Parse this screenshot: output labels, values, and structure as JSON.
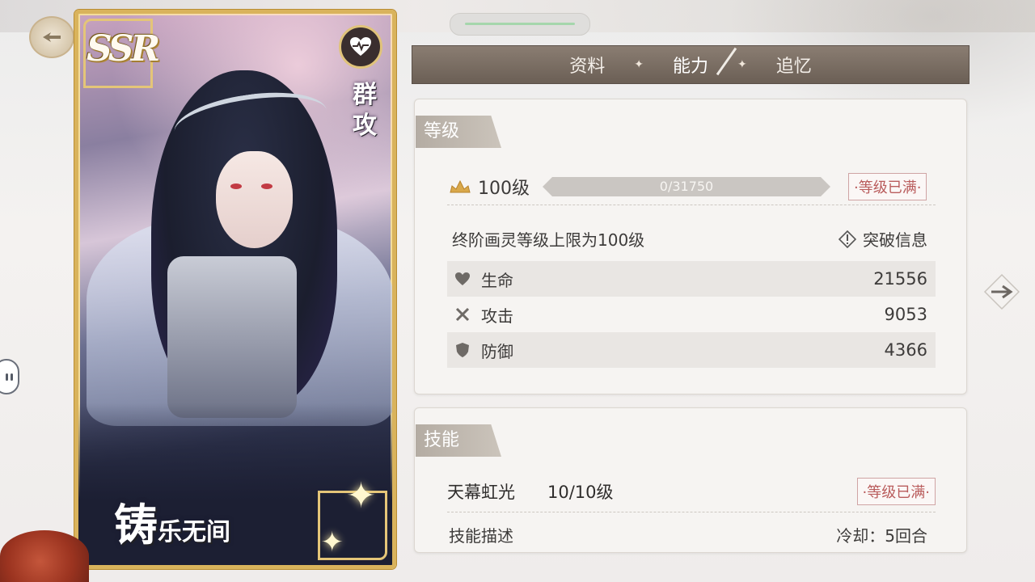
{
  "card": {
    "rarity": "SSR",
    "role": "群攻",
    "name_main": "铸",
    "name_sub": "乐无间"
  },
  "tabs": [
    "资料",
    "能力",
    "追忆"
  ],
  "tab_separator": "✦",
  "active_tab": "能力",
  "level_section": {
    "header": "等级",
    "level": "100级",
    "xp_text": "0/31750",
    "xp_fraction": 0,
    "max_badge": "·等级已满·",
    "cap_text": "终阶画灵等级上限为100级",
    "break_info": "突破信息",
    "stats": [
      {
        "icon": "heart-icon",
        "name": "生命",
        "value": "21556"
      },
      {
        "icon": "crossed-swords-icon",
        "name": "攻击",
        "value": "9053"
      },
      {
        "icon": "shield-icon",
        "name": "防御",
        "value": "4366"
      }
    ]
  },
  "skill_section": {
    "header": "技能",
    "skill_name": "天幕虹光",
    "skill_level": "10/10级",
    "max_badge": "·等级已满·",
    "desc_label": "技能描述",
    "cooldown": "冷却：5回合"
  },
  "colors": {
    "tab_bar": "#6b5f55",
    "card_border": "#d9b35c",
    "max_badge": "#b95c5c",
    "xp_bar": "#cac6c2"
  }
}
